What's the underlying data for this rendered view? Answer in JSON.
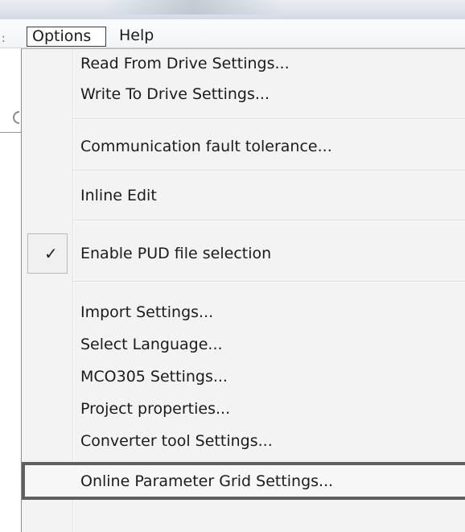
{
  "menubar": {
    "left_fragment": ":",
    "items": [
      {
        "label": "Options"
      },
      {
        "label": "Help"
      }
    ]
  },
  "options_menu": {
    "groups": [
      [
        {
          "label": "Read From Drive Settings..."
        },
        {
          "label": "Write To Drive Settings..."
        }
      ],
      [
        {
          "label": "Communication fault tolerance..."
        }
      ],
      [
        {
          "label": "Inline Edit"
        }
      ],
      [
        {
          "label": "Enable PUD file selection",
          "checked": true,
          "check_glyph": "✓"
        }
      ],
      [
        {
          "label": "Import Settings..."
        },
        {
          "label": "Select Language..."
        },
        {
          "label": "MCO305 Settings..."
        },
        {
          "label": "Project properties..."
        },
        {
          "label": "Converter tool Settings..."
        },
        {
          "label": "Online Parameter Grid Settings...",
          "highlighted": true
        }
      ]
    ]
  }
}
